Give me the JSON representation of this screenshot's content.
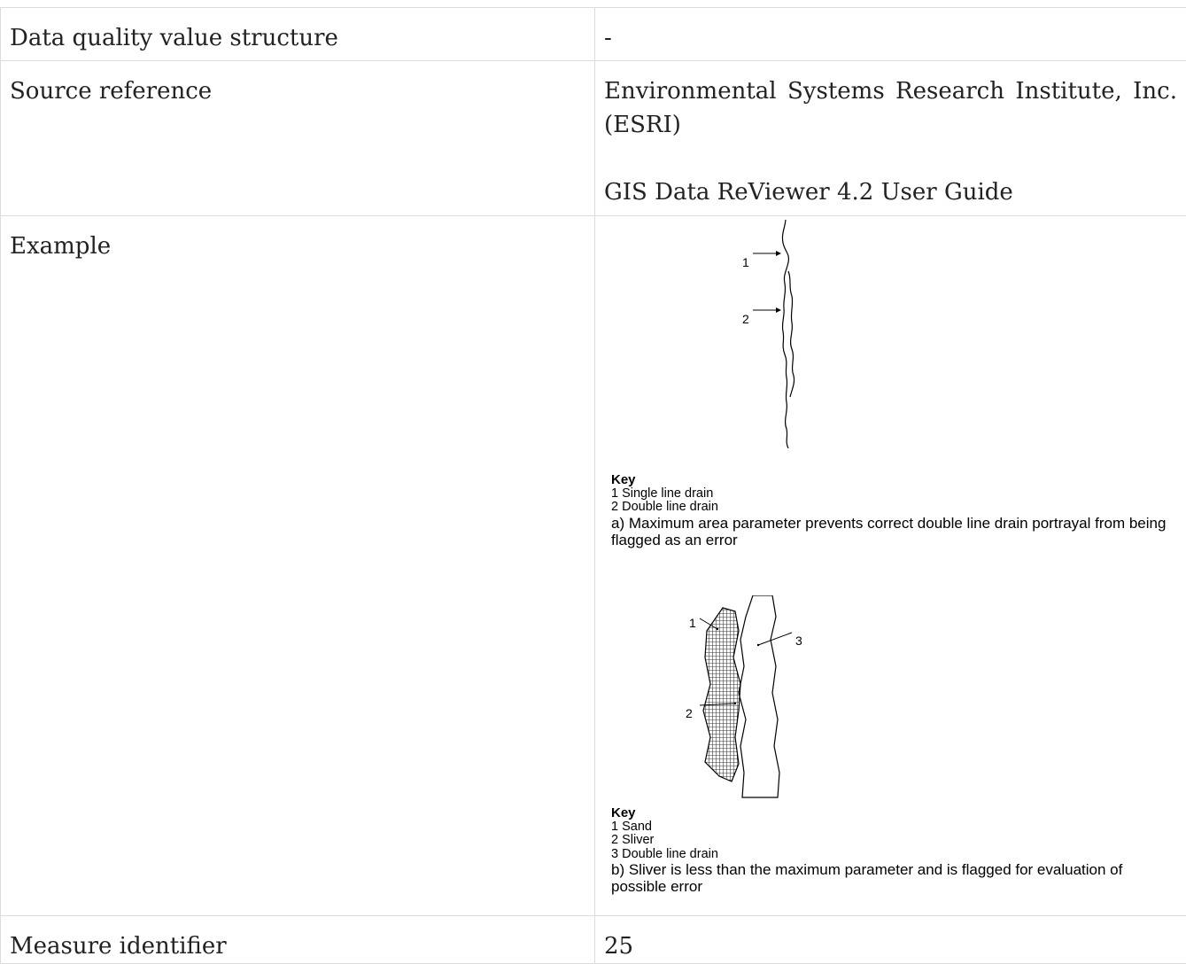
{
  "rows": {
    "data_quality_value_structure": {
      "label": "Data quality value structure",
      "value": "-"
    },
    "source_reference": {
      "label": "Source reference",
      "organization": "Environmental Systems Research Institute, Inc. (ESRI)",
      "document": "GIS Data ReViewer 4.2 User Guide"
    },
    "example": {
      "label": "Example",
      "figure_a": {
        "callouts": [
          "1",
          "2"
        ],
        "key_title": "Key",
        "key_items": [
          "1 Single line drain",
          "2 Double line drain"
        ],
        "caption": "a) Maximum area parameter prevents correct double line drain portrayal from being flagged as an error"
      },
      "figure_b": {
        "callouts": [
          "1",
          "2",
          "3"
        ],
        "key_title": "Key",
        "key_items": [
          "1 Sand",
          "2 Sliver",
          "3 Double line drain"
        ],
        "caption": "b) Sliver is less than the maximum parameter and is flagged for evaluation of possible error"
      }
    },
    "measure_identifier": {
      "label": "Measure identifier",
      "value": "25"
    }
  }
}
